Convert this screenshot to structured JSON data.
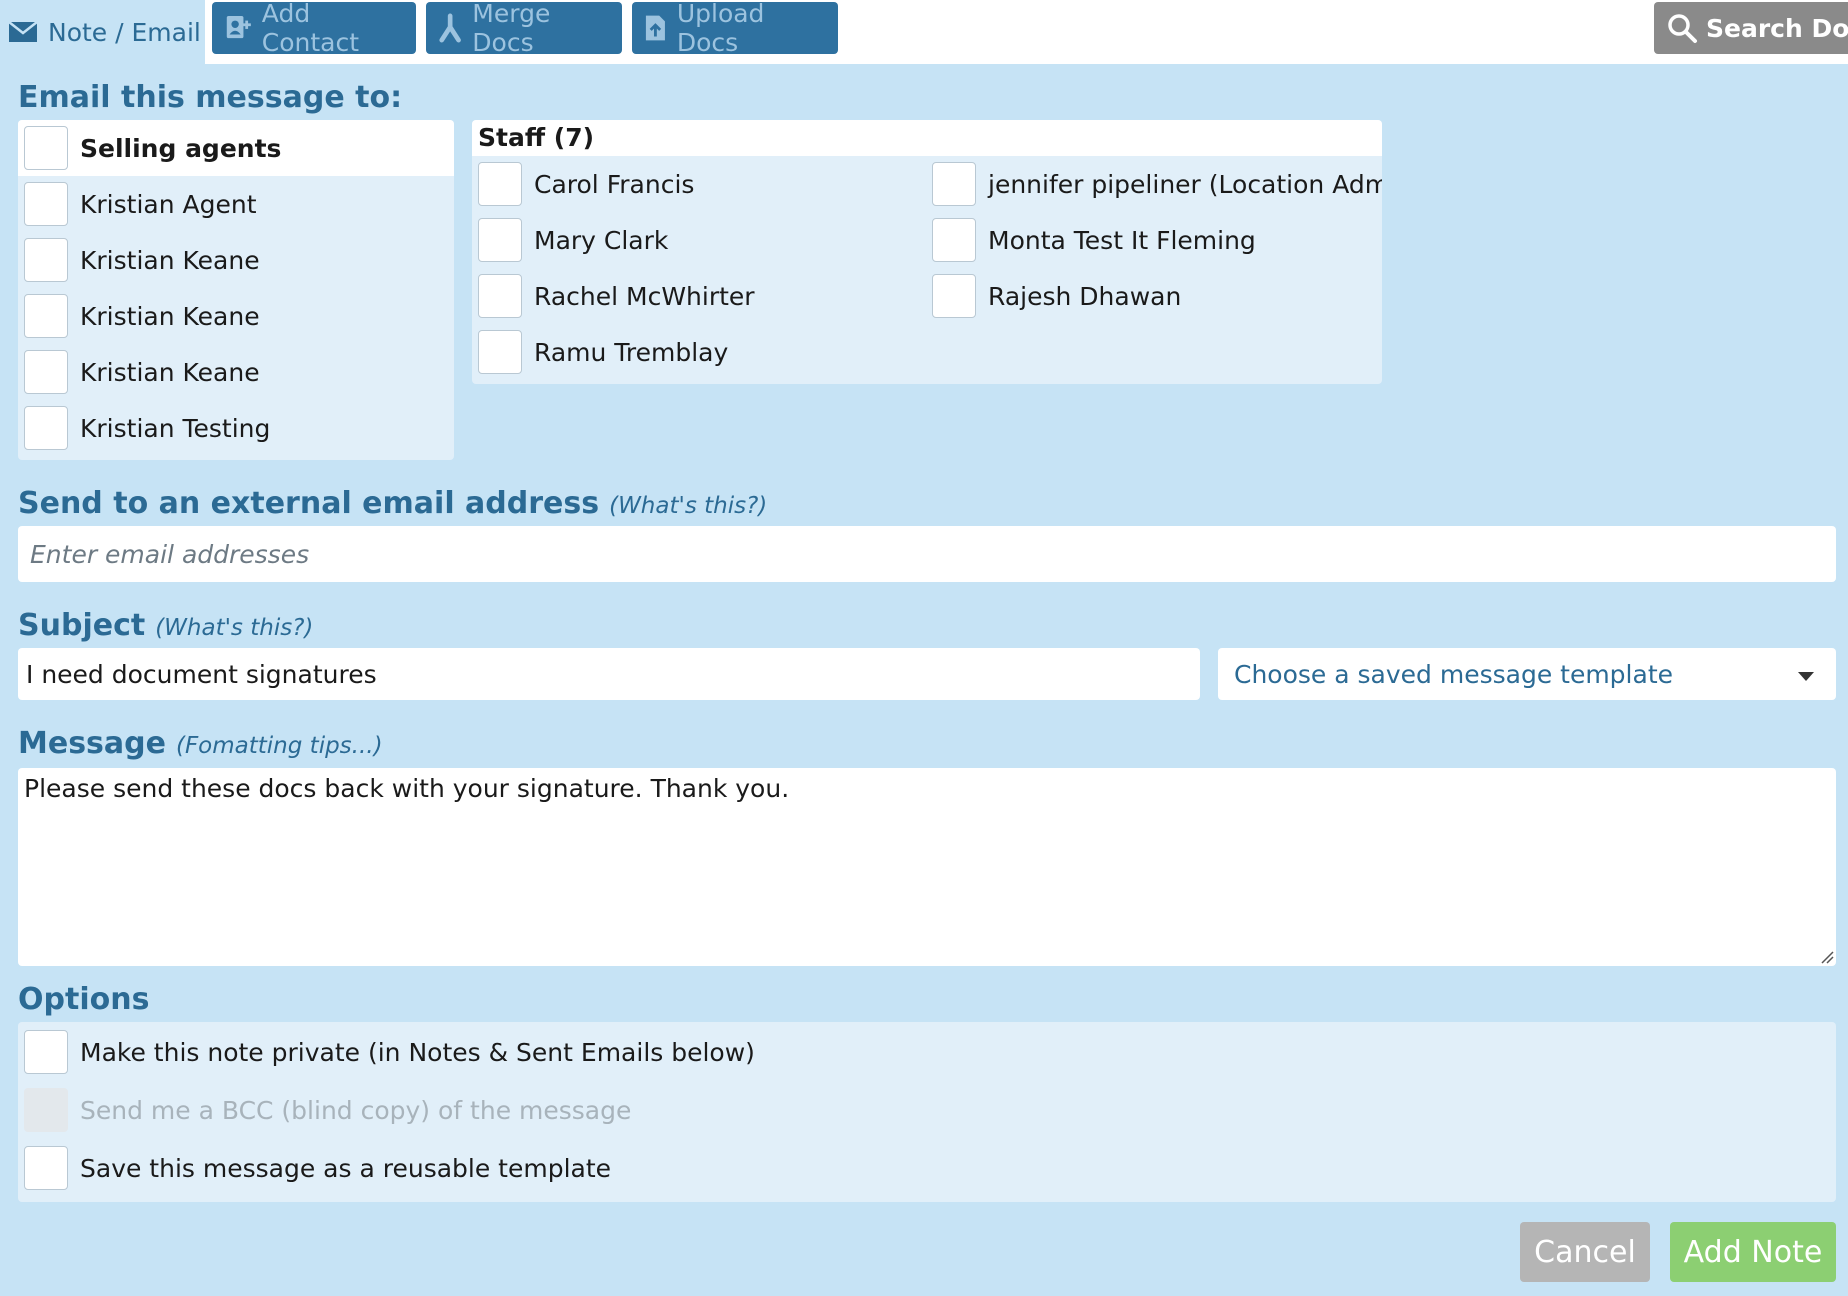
{
  "tabs": {
    "active_label": "Note / Email",
    "add_contact": "Add Contact",
    "merge_docs": "Merge Docs",
    "upload_docs": "Upload Docs",
    "search_docs": "Search Docs"
  },
  "recipients": {
    "title": "Email this message to:",
    "selling_agents": {
      "header": "Selling agents",
      "items": [
        "Kristian Agent",
        "Kristian Keane",
        "Kristian Keane",
        "Kristian Keane",
        "Kristian Testing"
      ]
    },
    "staff": {
      "header": "Staff (7)",
      "items": [
        "Carol Francis",
        "jennifer pipeliner (Location Admin)",
        "Mary Clark",
        "Monta Test It Fleming",
        "Rachel McWhirter",
        "Rajesh Dhawan",
        "Ramu Tremblay"
      ]
    }
  },
  "external": {
    "title": "Send to an external email address",
    "hint": "(What's this?)",
    "placeholder": "Enter email addresses"
  },
  "subject": {
    "title": "Subject",
    "hint": "(What's this?)",
    "value": "I need document signatures",
    "template_select": "Choose a saved message template"
  },
  "message": {
    "title": "Message",
    "hint": "(Fomatting tips...)",
    "value": "Please send these docs back with your signature. Thank you."
  },
  "options": {
    "title": "Options",
    "items": [
      "Make this note private (in Notes & Sent Emails below)",
      "Send me a BCC (blind copy) of the message",
      "Save this message as a reusable template"
    ]
  },
  "actions": {
    "cancel": "Cancel",
    "add_note": "Add Note"
  },
  "colors": {
    "background": "#c6e3f5",
    "accent": "#2b6a94",
    "tab_button": "#2e71a0",
    "add_button": "#8ccf72",
    "cancel_button": "#b5b5b5"
  }
}
